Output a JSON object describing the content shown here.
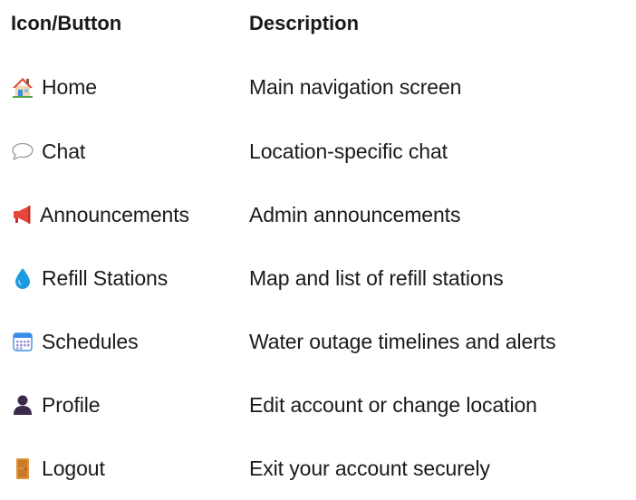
{
  "header": {
    "col_icon": "Icon/Button",
    "col_desc": "Description"
  },
  "rows": [
    {
      "icon": "house-icon",
      "label": "Home",
      "description": "Main navigation screen"
    },
    {
      "icon": "speech-bubble-icon",
      "label": "Chat",
      "description": "Location-specific chat"
    },
    {
      "icon": "megaphone-icon",
      "label": "Announcements",
      "description": "Admin announcements"
    },
    {
      "icon": "water-drop-icon",
      "label": "Refill Stations",
      "description": "Map and list of refill stations"
    },
    {
      "icon": "calendar-icon",
      "label": "Schedules",
      "description": "Water outage timelines and alerts"
    },
    {
      "icon": "person-icon",
      "label": "Profile",
      "description": "Edit account or change location"
    },
    {
      "icon": "door-icon",
      "label": "Logout",
      "description": "Exit your account securely"
    }
  ],
  "colors": {
    "text": "#1a1a1a",
    "house_roof": "#e8453c",
    "drop": "#1e9be0",
    "calendar": "#3a8ee6",
    "person": "#3b2a4a",
    "door": "#e0913a"
  }
}
